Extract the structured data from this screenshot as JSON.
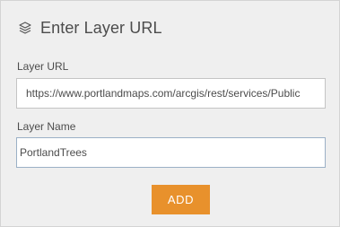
{
  "header": {
    "icon": "layers-icon",
    "title": "Enter Layer URL"
  },
  "layer_url": {
    "label": "Layer URL",
    "value": "https://www.portlandmaps.com/arcgis/rest/services/Public"
  },
  "layer_name": {
    "label": "Layer Name",
    "value": "PortlandTrees"
  },
  "add_button": {
    "label": "ADD",
    "color": "#e8912c"
  }
}
